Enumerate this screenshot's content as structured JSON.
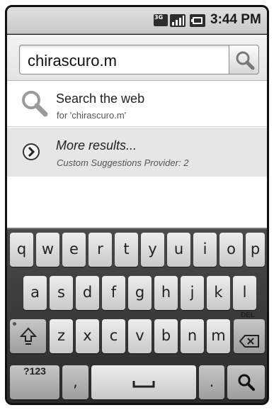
{
  "status_bar": {
    "network_label": "3G",
    "time": "3:44 PM"
  },
  "search": {
    "query": "chirascuro.m"
  },
  "suggestions": [
    {
      "title": "Search the web",
      "subtitle": "for 'chirascuro.m'"
    },
    {
      "title": "More results...",
      "subtitle": "Custom Suggestions Provider: 2"
    }
  ],
  "keyboard": {
    "row1": [
      "q",
      "w",
      "e",
      "r",
      "t",
      "y",
      "u",
      "i",
      "o",
      "p"
    ],
    "row2": [
      "a",
      "s",
      "d",
      "f",
      "g",
      "h",
      "j",
      "k",
      "l"
    ],
    "row3": [
      "z",
      "x",
      "c",
      "v",
      "b",
      "n",
      "m"
    ],
    "del_label": "DEL",
    "symbols_label": "?123",
    "comma": ",",
    "period": "."
  }
}
